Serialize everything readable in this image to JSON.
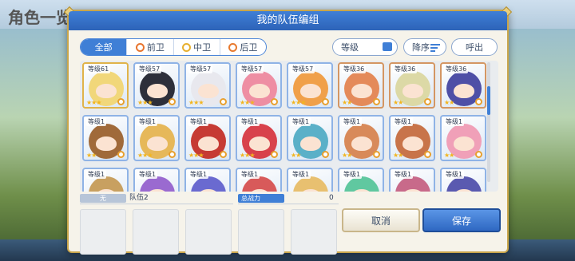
{
  "background": {
    "title": "角色一览",
    "bottom_labels": [
      "",
      "",
      "",
      "",
      ""
    ]
  },
  "modal": {
    "title": "我的队伍编组",
    "filters": [
      {
        "label": "全部",
        "active": true
      },
      {
        "label": "前卫",
        "active": false
      },
      {
        "label": "中卫",
        "active": false
      },
      {
        "label": "后卫",
        "active": false
      }
    ],
    "sort_level_label": "等级",
    "sort_order_label": "降序",
    "call_label": "呼出"
  },
  "characters": [
    {
      "level": "等级61",
      "stars": "★★★",
      "frame": "gold",
      "hair": "#f1d77a"
    },
    {
      "level": "等级57",
      "stars": "★★★",
      "frame": "blue",
      "hair": "#2d2f3a"
    },
    {
      "level": "等级57",
      "stars": "★★★",
      "frame": "blue",
      "hair": "#e8e8ee"
    },
    {
      "level": "等级57",
      "stars": "★★★",
      "frame": "blue",
      "hair": "#ee8ea3"
    },
    {
      "level": "等级57",
      "stars": "★★★",
      "frame": "blue",
      "hair": "#f0a04a"
    },
    {
      "level": "等级36",
      "stars": "★★",
      "frame": "copper",
      "hair": "#e48a5a"
    },
    {
      "level": "等级36",
      "stars": "★★",
      "frame": "copper",
      "hair": "#dcd9a6"
    },
    {
      "level": "等级36",
      "stars": "★★",
      "frame": "copper",
      "hair": "#4e4fa6"
    },
    {
      "level": "等级1",
      "stars": "★★",
      "frame": "blue",
      "hair": "#a06a3a"
    },
    {
      "level": "等级1",
      "stars": "★★★",
      "frame": "blue",
      "hair": "#e6b85a"
    },
    {
      "level": "等级1",
      "stars": "★★★",
      "frame": "blue",
      "hair": "#c63b34"
    },
    {
      "level": "等级1",
      "stars": "★★★",
      "frame": "blue",
      "hair": "#d8424c"
    },
    {
      "level": "等级1",
      "stars": "★★",
      "frame": "blue",
      "hair": "#5ab0c8"
    },
    {
      "level": "等级1",
      "stars": "★★",
      "frame": "blue",
      "hair": "#d88a5a"
    },
    {
      "level": "等级1",
      "stars": "★★",
      "frame": "blue",
      "hair": "#c8744a"
    },
    {
      "level": "等级1",
      "stars": "★★",
      "frame": "blue",
      "hair": "#f0a0b8"
    },
    {
      "level": "等级1",
      "stars": "",
      "frame": "blue",
      "hair": "#c8a060"
    },
    {
      "level": "等级1",
      "stars": "",
      "frame": "blue",
      "hair": "#9a6ad0"
    },
    {
      "level": "等级1",
      "stars": "",
      "frame": "blue",
      "hair": "#6a6ad0"
    },
    {
      "level": "等级1",
      "stars": "",
      "frame": "blue",
      "hair": "#d85a5a"
    },
    {
      "level": "等级1",
      "stars": "",
      "frame": "blue",
      "hair": "#e8c070"
    },
    {
      "level": "等级1",
      "stars": "",
      "frame": "blue",
      "hair": "#60c8a0"
    },
    {
      "level": "等级1",
      "stars": "",
      "frame": "blue",
      "hair": "#c86a8a"
    },
    {
      "level": "等级1",
      "stars": "",
      "frame": "blue",
      "hair": "#5a5ab0"
    }
  ],
  "team": {
    "badge": "无",
    "name": "队伍2",
    "power_label": "总战力",
    "power_value": "0"
  },
  "buttons": {
    "cancel": "取消",
    "save": "保存"
  }
}
